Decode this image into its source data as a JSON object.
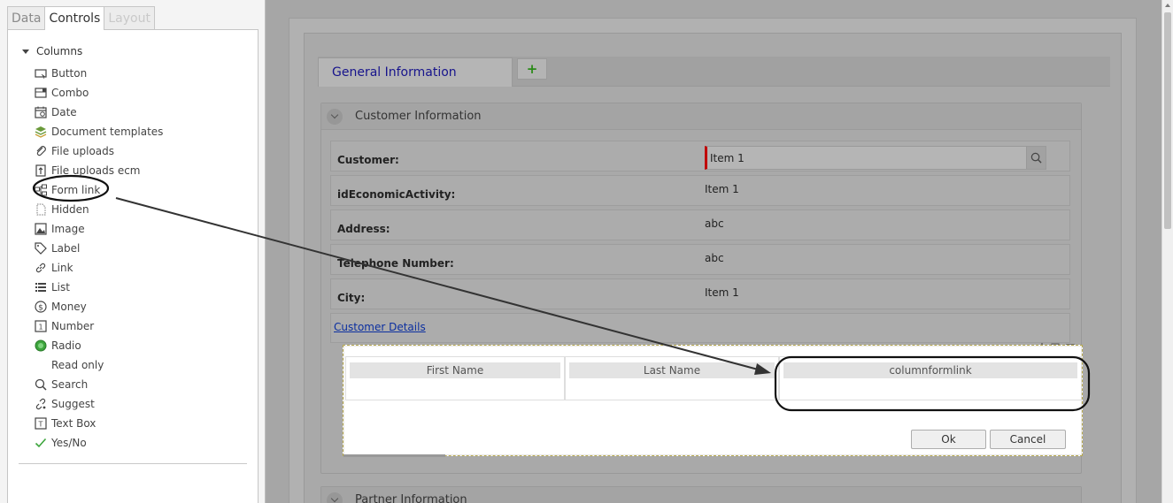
{
  "left_panel": {
    "tabs": [
      {
        "label": "Data",
        "state": "inactive"
      },
      {
        "label": "Controls",
        "state": "active"
      },
      {
        "label": "Layout",
        "state": "disabled"
      }
    ],
    "tree_root": "Columns",
    "controls": [
      {
        "label": "Button",
        "icon": "button-icon"
      },
      {
        "label": "Combo",
        "icon": "combo-icon"
      },
      {
        "label": "Date",
        "icon": "calendar-icon"
      },
      {
        "label": "Document templates",
        "icon": "document-templates-icon"
      },
      {
        "label": "File uploads",
        "icon": "paperclip-icon"
      },
      {
        "label": "File uploads ecm",
        "icon": "file-upload-ecm-icon"
      },
      {
        "label": "Form link",
        "icon": "form-link-icon"
      },
      {
        "label": "Hidden",
        "icon": "hidden-icon"
      },
      {
        "label": "Image",
        "icon": "image-icon"
      },
      {
        "label": "Label",
        "icon": "tag-icon"
      },
      {
        "label": "Link",
        "icon": "link-icon"
      },
      {
        "label": "List",
        "icon": "list-icon"
      },
      {
        "label": "Money",
        "icon": "money-icon"
      },
      {
        "label": "Number",
        "icon": "number-icon"
      },
      {
        "label": "Radio",
        "icon": "radio-icon"
      },
      {
        "label": "Read only",
        "icon": "none"
      },
      {
        "label": "Search",
        "icon": "search-icon"
      },
      {
        "label": "Suggest",
        "icon": "suggest-icon"
      },
      {
        "label": "Text Box",
        "icon": "text-box-icon"
      },
      {
        "label": "Yes/No",
        "icon": "checkmark-icon"
      }
    ]
  },
  "form": {
    "tab_label": "General Information",
    "add_tab_symbol": "+",
    "sections": [
      {
        "title": "Customer Information"
      },
      {
        "title": "Partner Information"
      }
    ],
    "fields": [
      {
        "label": "Customer:",
        "value": "Item 1",
        "type": "lookup"
      },
      {
        "label": "idEconomicActivity:",
        "value": "Item 1",
        "type": "text"
      },
      {
        "label": "Address:",
        "value": "abc",
        "type": "text"
      },
      {
        "label": "Telephone Number:",
        "value": "abc",
        "type": "text"
      },
      {
        "label": "City:",
        "value": "Item 1",
        "type": "text"
      }
    ],
    "details_link": "Customer Details"
  },
  "dialog": {
    "columns": [
      "First Name",
      "Last Name",
      "columnformlink"
    ],
    "ok_label": "Ok",
    "cancel_label": "Cancel"
  },
  "colors": {
    "form_tab_text": "#17148c",
    "required_marker": "#c00000",
    "add_tab_icon": "#2a8a18",
    "link": "#0b2fa0",
    "radio_icon": "#3da53d",
    "checkmark_icon": "#3da53d"
  }
}
